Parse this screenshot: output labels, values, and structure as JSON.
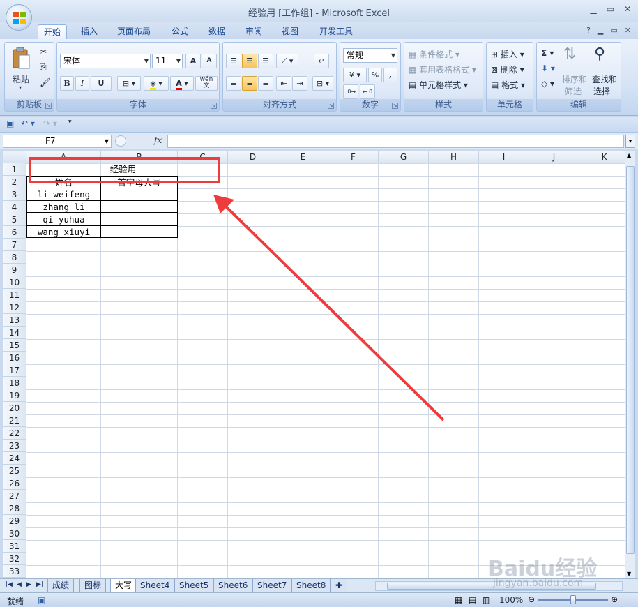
{
  "window": {
    "title": "经验用  [工作组] - Microsoft Excel"
  },
  "ribbon_tabs": [
    "开始",
    "插入",
    "页面布局",
    "公式",
    "数据",
    "审阅",
    "视图",
    "开发工具"
  ],
  "ribbon": {
    "clipboard": {
      "label": "剪贴板",
      "paste": "粘贴"
    },
    "font": {
      "label": "字体",
      "font_name": "宋体",
      "font_size": "11",
      "bold": "B",
      "italic": "I",
      "underline": "U",
      "grow": "A",
      "shrink": "A",
      "color_a": "A",
      "phonetic": "wén\n文"
    },
    "alignment": {
      "label": "对齐方式"
    },
    "number": {
      "label": "数字",
      "format": "常规",
      "percent": "%",
      "comma": ","
    },
    "styles": {
      "label": "样式",
      "conditional": "条件格式",
      "table_format": "套用表格格式",
      "cell_styles": "单元格样式"
    },
    "cells": {
      "label": "单元格",
      "insert": "插入",
      "delete": "删除",
      "format": "格式"
    },
    "editing": {
      "label": "编辑",
      "sum": "Σ",
      "sort_filter_1": "排序和",
      "sort_filter_2": "筛选",
      "find_select_1": "查找和",
      "find_select_2": "选择"
    }
  },
  "formula_bar": {
    "name_box": "F7",
    "fx": "fx",
    "value": ""
  },
  "columns": [
    "A",
    "B",
    "C",
    "D",
    "E",
    "F",
    "G",
    "H",
    "I",
    "J",
    "K"
  ],
  "rows": [
    "1",
    "2",
    "3",
    "4",
    "5",
    "6",
    "7",
    "8",
    "9",
    "10",
    "11",
    "12",
    "13",
    "14",
    "15",
    "16",
    "17",
    "18",
    "19",
    "20",
    "21",
    "22",
    "23",
    "24",
    "25",
    "26",
    "27",
    "28",
    "29",
    "30",
    "31",
    "32",
    "33"
  ],
  "sheet": {
    "title": "经验用",
    "header_name": "姓名",
    "header_initial": "首字母大写",
    "names": [
      "li weifeng",
      "zhang li",
      "qi yuhua",
      "wang xiuyi"
    ]
  },
  "sheet_tabs": [
    "成绩",
    "图标",
    "大写",
    "Sheet4",
    "Sheet5",
    "Sheet6",
    "Sheet7",
    "Sheet8"
  ],
  "active_sheet": "大写",
  "status": {
    "ready": "就绪",
    "zoom": "100%"
  },
  "watermark": {
    "brand": "Baidu经验",
    "url": "jingyan.baidu.com"
  },
  "colors": {
    "annotation": "#ee3b3b",
    "ribbon_accent": "#15428b",
    "selected_button": "#f7c45b"
  }
}
